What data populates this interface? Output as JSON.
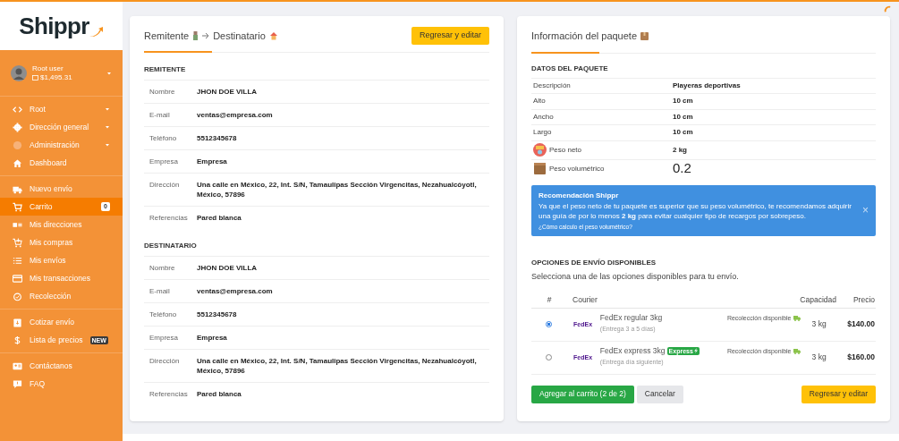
{
  "sidebar": {
    "logo": "Shippr",
    "user": {
      "name": "Root user",
      "balance": "$1,495.31",
      "submenu": true
    },
    "sections": [
      [
        {
          "label": "Root",
          "submenu": true,
          "selected": false
        },
        {
          "label": "Dirección general",
          "submenu": true,
          "selected": false
        },
        {
          "label": "Administración",
          "submenu": true,
          "selected": false
        },
        {
          "label": "Dashboard",
          "submenu": false,
          "selected": false
        }
      ],
      [
        {
          "label": "Nuevo envío",
          "submenu": false,
          "selected": false
        },
        {
          "label": "Carrito",
          "submenu": false,
          "selected": true,
          "badge": {
            "text": "0",
            "kind": "count"
          }
        },
        {
          "label": "Mis direcciones",
          "submenu": false,
          "selected": false
        },
        {
          "label": "Mis compras",
          "submenu": false,
          "selected": false
        },
        {
          "label": "Mis envíos",
          "submenu": false,
          "selected": false
        },
        {
          "label": "Mis transacciones",
          "submenu": false,
          "selected": false
        },
        {
          "label": "Recolección",
          "submenu": false,
          "selected": false
        }
      ],
      [
        {
          "label": "Cotizar envío",
          "submenu": false,
          "selected": false
        },
        {
          "label": "Lista de precios",
          "submenu": false,
          "selected": false,
          "badge": {
            "text": "NEW",
            "kind": "new"
          }
        }
      ],
      [
        {
          "label": "Contáctanos",
          "submenu": false,
          "selected": false
        },
        {
          "label": "FAQ",
          "submenu": false,
          "selected": false
        }
      ]
    ]
  },
  "contacts_card": {
    "title_from": "Remitente",
    "title_to": "Destinatario",
    "button": "Regresar y editar",
    "sections": [
      {
        "heading": "REMITENTE",
        "rows": [
          {
            "label": "Nombre",
            "value": "JHON DOE VILLA"
          },
          {
            "label": "E-mail",
            "value": "ventas@empresa.com"
          },
          {
            "label": "Teléfono",
            "value": "5512345678"
          },
          {
            "label": "Empresa",
            "value": "Empresa"
          },
          {
            "label": "Dirección",
            "value": "Una calle en México, 22, Int. S/N, Tamaulipas Sección Virgencitas, Nezahualcóyotl, México, 57896"
          },
          {
            "label": "Referencias",
            "value": "Pared blanca"
          }
        ]
      },
      {
        "heading": "DESTINATARIO",
        "rows": [
          {
            "label": "Nombre",
            "value": "JHON DOE VILLA"
          },
          {
            "label": "E-mail",
            "value": "ventas@empresa.com"
          },
          {
            "label": "Teléfono",
            "value": "5512345678"
          },
          {
            "label": "Empresa",
            "value": "Empresa"
          },
          {
            "label": "Dirección",
            "value": "Una calle en México, 22, Int. S/N, Tamaulipas Sección Virgencitas, Nezahualcóyotl, México, 57896"
          },
          {
            "label": "Referencias",
            "value": "Pared blanca"
          }
        ]
      }
    ]
  },
  "package_card": {
    "title": "Información del paquete",
    "heading": "DATOS DEL PAQUETE",
    "rows": [
      {
        "kind": "plain",
        "label": "Descripción",
        "value": "Playeras deportivas"
      },
      {
        "kind": "plain",
        "label": "Alto",
        "value": "10 cm"
      },
      {
        "kind": "plain",
        "label": "Ancho",
        "value": "10 cm"
      },
      {
        "kind": "plain",
        "label": "Largo",
        "value": "10 cm"
      },
      {
        "kind": "scale",
        "label": "Peso neto",
        "value": "2 kg"
      },
      {
        "kind": "volume",
        "label": "Peso volumétrico",
        "value": "0.2"
      }
    ],
    "alert": {
      "title": "Recomendación Shippr",
      "message": "Ya que el peso neto de tu paquete es superior que su peso volumétrico, te recomendamos adquirir una guía de por lo menos **2 kg** para evitar cualquier tipo de recargos por sobrepeso.",
      "link": "¿Cómo calculo el peso volumétrico?",
      "close": "×"
    },
    "options": {
      "heading": "OPCIONES DE ENVÍO DISPONIBLES",
      "subtitle": "Selecciona una de las opciones disponibles para tu envío.",
      "columns": [
        "#",
        "Courier",
        "Capacidad",
        "Precio"
      ],
      "rows": [
        {
          "selected": true,
          "logo": "FedEx",
          "name": "FedEx regular 3kg",
          "delivery": "(Entrega 3 a 5 días)",
          "pickup": "Recolección disponible",
          "capacity": "3 kg",
          "price": "$140.00"
        },
        {
          "selected": false,
          "logo": "FedEx",
          "name": "FedEx express 3kg",
          "badge": "Express",
          "delivery": "(Entrega día siguiente)",
          "pickup": "Recolección disponible",
          "capacity": "3 kg",
          "price": "$160.00"
        }
      ]
    },
    "buttons": [
      {
        "kind": "primary",
        "label": "Agregar al carrito (2 de 2)"
      },
      {
        "kind": "secondary",
        "label": "Cancelar"
      },
      {
        "kind": "warning",
        "label": "Regresar y editar"
      }
    ]
  }
}
